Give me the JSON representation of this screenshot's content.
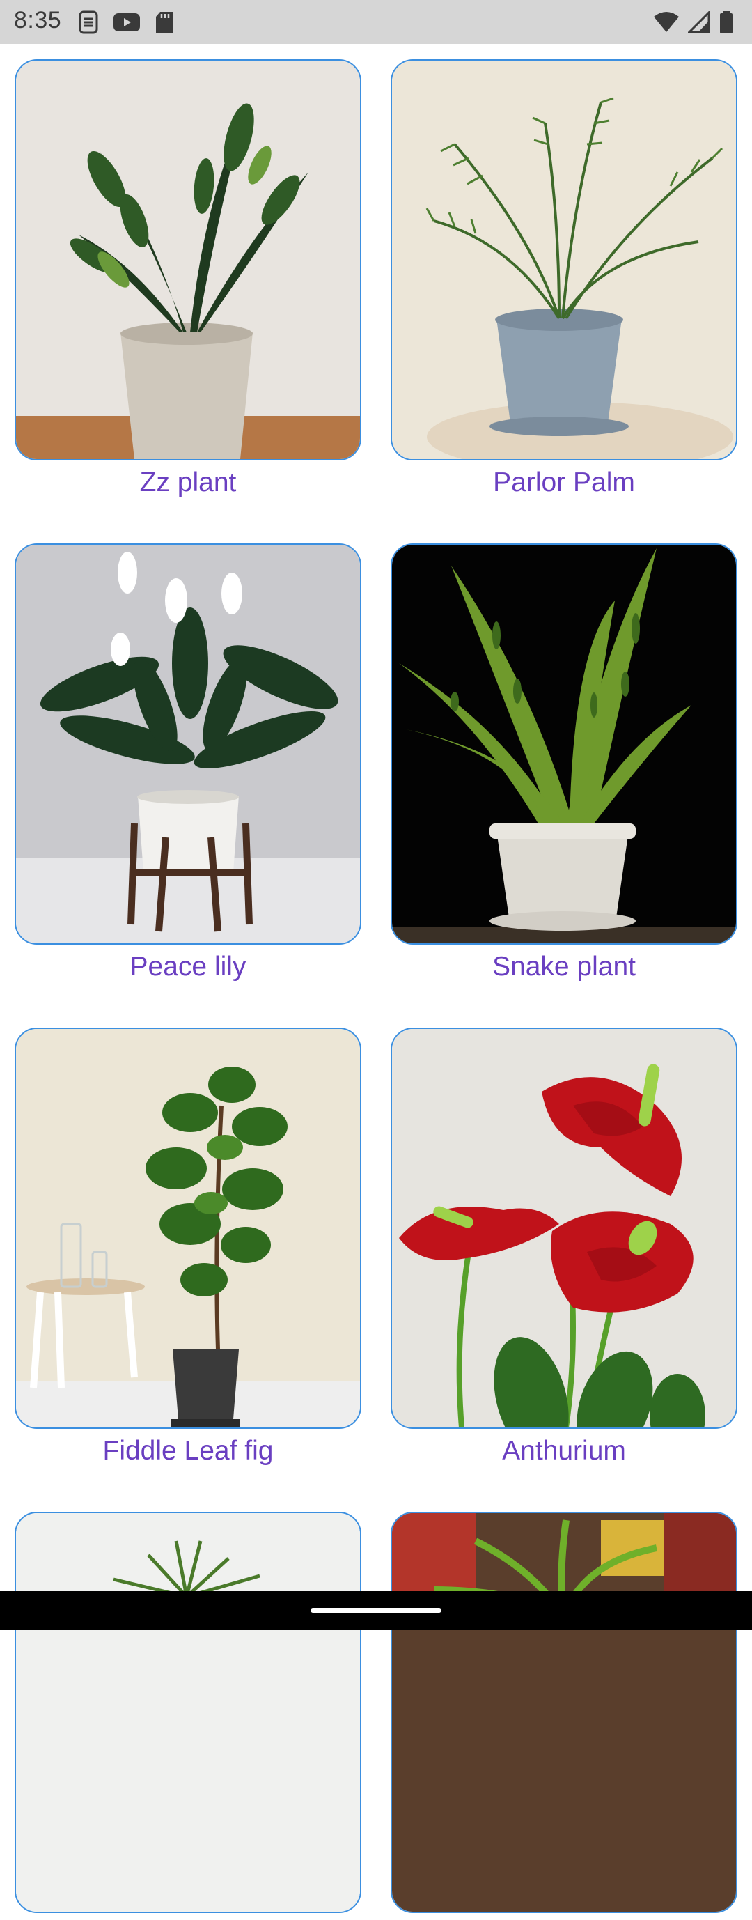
{
  "status_bar": {
    "time": "8:35",
    "left_icons": [
      "app-notification-icon",
      "youtube-icon",
      "sd-card-icon"
    ],
    "right_icons": [
      "wifi-icon",
      "signal-icon",
      "battery-icon"
    ]
  },
  "plants": [
    {
      "name": "Zz plant"
    },
    {
      "name": "Parlor Palm"
    },
    {
      "name": "Peace lily"
    },
    {
      "name": "Snake plant"
    },
    {
      "name": "Fiddle Leaf fig"
    },
    {
      "name": "Anthurium"
    },
    {
      "name": ""
    },
    {
      "name": ""
    }
  ],
  "colors": {
    "card_border": "#3b8fe0",
    "label_text": "#6a3fc1",
    "status_bar": "#d6d6d6"
  }
}
